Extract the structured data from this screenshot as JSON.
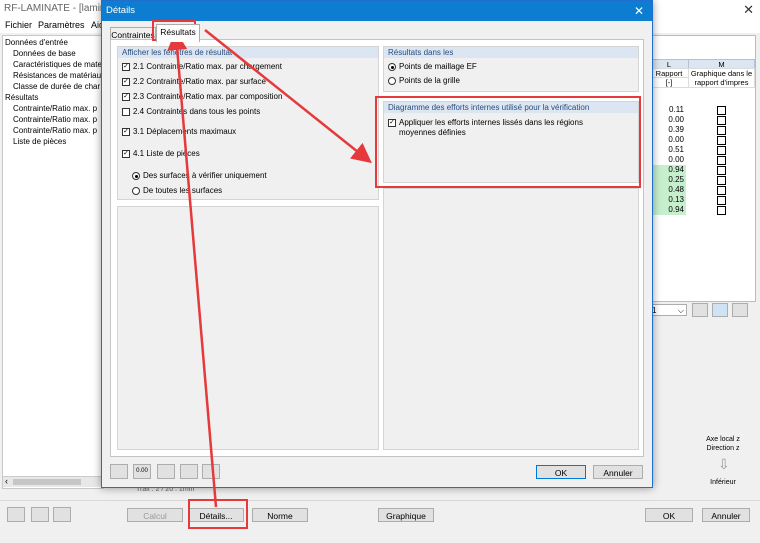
{
  "main_window": {
    "title": "RF-LAMINATE - [laminate]",
    "close": "✕",
    "menu": [
      "Fichier",
      "Paramètres",
      "Aid"
    ]
  },
  "tree": {
    "items": [
      "Données d'entrée",
      "Données de base",
      "Caractéristiques de mate",
      "Résistances de matériau",
      "Classe de durée de char",
      "Résultats",
      "Contrainte/Ratio max. p",
      "Contrainte/Ratio max. p",
      "Contrainte/Ratio max. p",
      "Liste de pièces"
    ]
  },
  "bg_table": {
    "col_l_letter": "L",
    "col_m_letter": "M",
    "col_l_header": "Rapport",
    "col_l_unit": "[-]",
    "col_m_header": "Graphique dans le rapport d'impres",
    "values": [
      "0.11",
      "0.00",
      "0.39",
      "0.00",
      "0.51",
      "0.00",
      "0.94",
      "0.25",
      "0.48",
      "0.13",
      "0.94"
    ],
    "highlight_color": "#c6efce",
    "combo_value": "1",
    "axis_label_1": "Axe local z",
    "axis_label_2": "Direction z",
    "axis_label_3": "Inférieur",
    "hscroll_text": "Trait : 2 / 20 . 1mm"
  },
  "bottom_bar": {
    "calcul": "Calcul",
    "details": "Détails...",
    "norme": "Norme",
    "graphique": "Graphique",
    "ok": "OK",
    "annuler": "Annuler"
  },
  "dialog": {
    "title": "Détails",
    "close": "✕",
    "tabs": [
      "Contraintes",
      "Résultats"
    ],
    "left_group": {
      "header": "Afficher les fenêtres de résultat",
      "items": [
        {
          "label": "2.1 Contrainte/Ratio max. par chargement",
          "checked": true
        },
        {
          "label": "2.2 Contrainte/Ratio max. par surface",
          "checked": true
        },
        {
          "label": "2.3 Contrainte/Ratio max. par composition",
          "checked": true
        },
        {
          "label": "2.4 Contraintes dans tous les points",
          "checked": false
        },
        {
          "label": "3.1 Déplacements maximaux",
          "checked": true
        },
        {
          "label": "4.1 Liste de pièces",
          "checked": true
        }
      ],
      "radio_1": "Des surfaces à vérifier uniquement",
      "radio_2": "De toutes les surfaces"
    },
    "right_group_1": {
      "header": "Résultats dans les",
      "radio_1": "Points de maillage EF",
      "radio_2": "Points de la grille"
    },
    "right_group_2": {
      "header": "Diagramme des efforts internes utilisé pour la vérification",
      "check_line_1": "Appliquer les efforts internes lissés dans les régions",
      "check_line_2": "moyennes définies"
    },
    "ok": "OK",
    "annuler": "Annuler",
    "icon_value": "0.00"
  },
  "colors": {
    "dialog_title_bg": "#0c7dd0",
    "group_header_bg": "#dce6f2",
    "annotation_red": "#e5393c"
  }
}
